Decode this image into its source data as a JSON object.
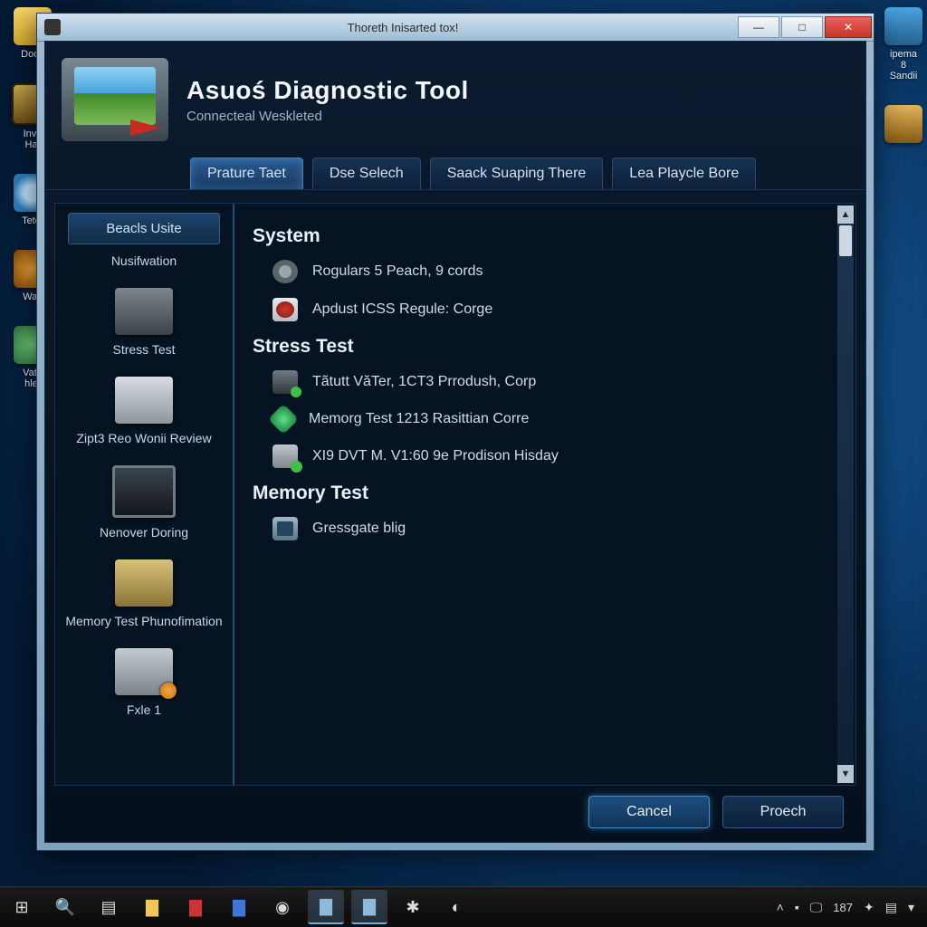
{
  "desktop": {
    "left_icons": [
      {
        "label": "Dooc",
        "cls": "di-folder"
      },
      {
        "label": "Inve\nHat",
        "cls": "di-box"
      },
      {
        "label": "Tetet",
        "cls": "di-disc"
      },
      {
        "label": "Way",
        "cls": "di-orb"
      },
      {
        "label": "Vate\nhlet",
        "cls": "di-globe"
      }
    ],
    "right_icons": [
      {
        "label": "ipema\n8\nSandii",
        "cls": "di-app1"
      },
      {
        "label": "",
        "cls": "di-tool"
      }
    ]
  },
  "taskbar": {
    "tray_count": "187"
  },
  "window": {
    "title": "Thoreth Inisarted tox!",
    "minimize": "—",
    "maximize": "□",
    "close": "✕"
  },
  "app": {
    "title": "Asuoś Diagnostic Tool",
    "subtitle": "Connecteal Weskleted",
    "tabs": [
      {
        "label": "Prature Taet",
        "active": true
      },
      {
        "label": "Dse Selech",
        "active": false
      },
      {
        "label": "Saack Suaping There",
        "active": false
      },
      {
        "label": "Lea Playcle Bore",
        "active": false
      }
    ]
  },
  "sidebar": {
    "header": "Beacls Usite",
    "items": [
      {
        "label": "Nusifwation",
        "icon": ""
      },
      {
        "label": "Stress Test",
        "icon": "tower"
      },
      {
        "label": "Zipt3 Reo Wonii Review",
        "icon": "panel"
      },
      {
        "label": "Nenover Doring",
        "icon": "monitor"
      },
      {
        "label": "Memory Test Phunofimation",
        "icon": "cube"
      },
      {
        "label": "Fxle 1",
        "icon": "disp"
      }
    ]
  },
  "main": {
    "sections": [
      {
        "heading": "System",
        "rows": [
          {
            "icon": "gear",
            "text": "Rogulars 5 Peach, 9 cords"
          },
          {
            "icon": "shield",
            "text": "Apdust ICSS Regule: Corge"
          }
        ]
      },
      {
        "heading": "Stress Test",
        "rows": [
          {
            "icon": "mon",
            "text": "Tãtutt VăTer, 1CT3 Prrodush, Corp"
          },
          {
            "icon": "gem",
            "text": "Memorg Test 1213 Rasittian Corre"
          },
          {
            "icon": "pack",
            "text": "XI9 DVT M. V1:60 9e Prodison Hisday"
          }
        ]
      },
      {
        "heading": "Memory Test",
        "rows": [
          {
            "icon": "chip",
            "text": "Gressgate blig"
          }
        ]
      }
    ]
  },
  "footer": {
    "cancel": "Cancel",
    "proceed": "Proech"
  }
}
